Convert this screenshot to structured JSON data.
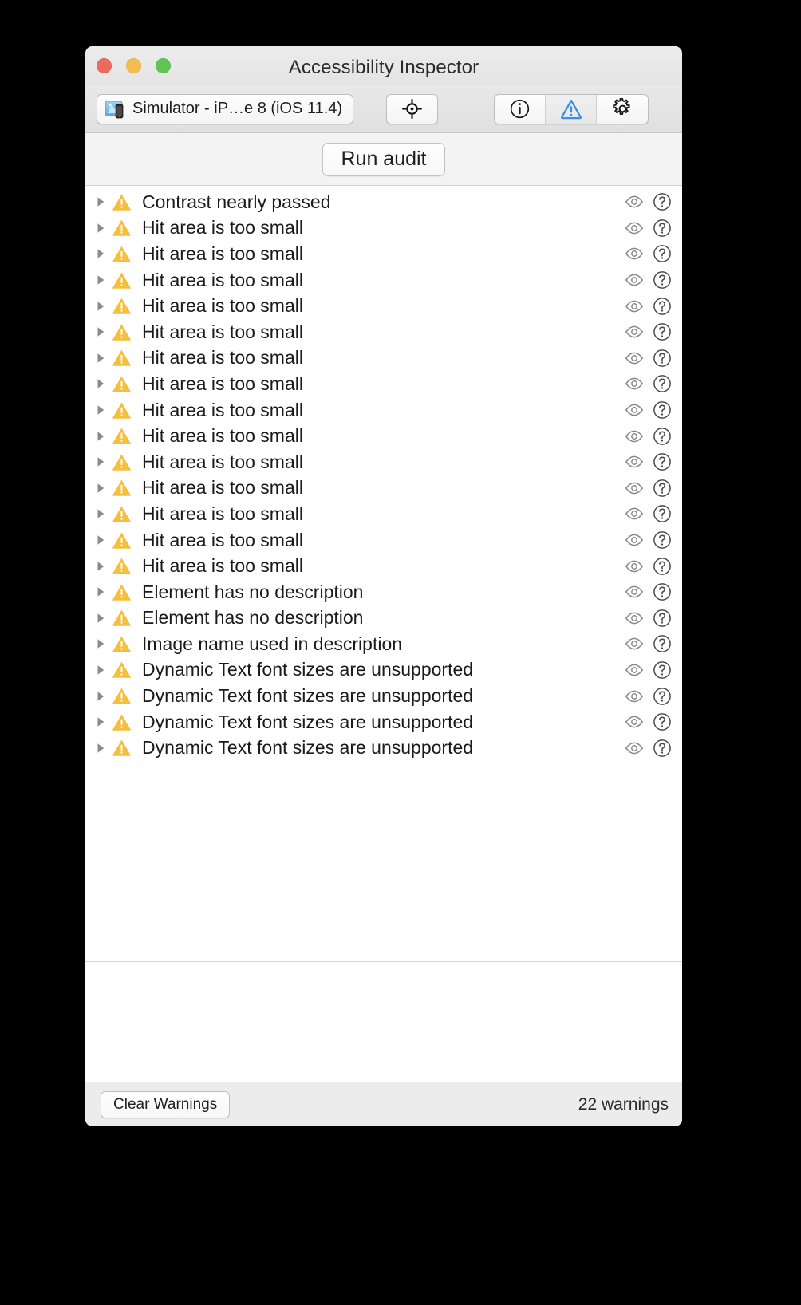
{
  "window": {
    "title": "Accessibility Inspector",
    "traffic_lights": [
      {
        "name": "close",
        "color": "#ed6a5e"
      },
      {
        "name": "minimize",
        "color": "#f5bd4f"
      },
      {
        "name": "zoom",
        "color": "#61c554"
      }
    ]
  },
  "toolbar": {
    "device_selector": {
      "label": "Simulator - iP…e 8 (iOS 11.4)",
      "icon": "simulator-icon"
    },
    "inspect_button": {
      "icon": "target-crosshair-icon",
      "label": ""
    },
    "mode_buttons": [
      {
        "name": "info",
        "icon": "info-circle-icon",
        "selected": false
      },
      {
        "name": "audit",
        "icon": "warning-triangle-icon",
        "selected": true
      },
      {
        "name": "settings",
        "icon": "gear-icon",
        "selected": false
      }
    ],
    "accent_color": "#3b8fe8"
  },
  "audit_bar": {
    "run_audit_label": "Run audit"
  },
  "warning_list": {
    "row_icons": {
      "disclosure": "disclosure-triangle-icon",
      "severity": "warning-triangle-icon",
      "preview": "eye-icon",
      "help": "question-mark-circle-icon"
    },
    "severity_color": "#f5bf3e",
    "rows": [
      {
        "label": "Contrast nearly passed"
      },
      {
        "label": "Hit area is too small"
      },
      {
        "label": "Hit area is too small"
      },
      {
        "label": "Hit area is too small"
      },
      {
        "label": "Hit area is too small"
      },
      {
        "label": "Hit area is too small"
      },
      {
        "label": "Hit area is too small"
      },
      {
        "label": "Hit area is too small"
      },
      {
        "label": "Hit area is too small"
      },
      {
        "label": "Hit area is too small"
      },
      {
        "label": "Hit area is too small"
      },
      {
        "label": "Hit area is too small"
      },
      {
        "label": "Hit area is too small"
      },
      {
        "label": "Hit area is too small"
      },
      {
        "label": "Hit area is too small"
      },
      {
        "label": "Element has no description"
      },
      {
        "label": "Element has no description"
      },
      {
        "label": "Image name used in description"
      },
      {
        "label": "Dynamic Text font sizes are unsupported"
      },
      {
        "label": "Dynamic Text font sizes are unsupported"
      },
      {
        "label": "Dynamic Text font sizes are unsupported"
      },
      {
        "label": "Dynamic Text font sizes are unsupported"
      }
    ]
  },
  "status_bar": {
    "clear_warnings_label": "Clear Warnings",
    "warning_count": "22 warnings"
  }
}
